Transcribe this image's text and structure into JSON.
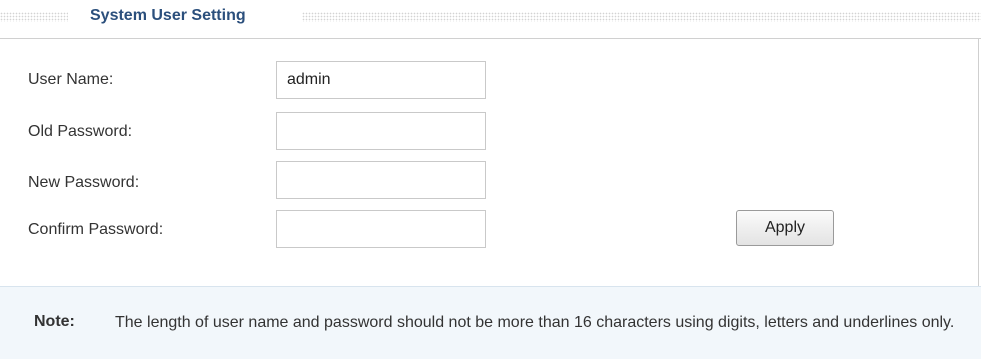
{
  "section": {
    "title": "System User Setting"
  },
  "form": {
    "username_label": "User Name:",
    "username_value": "admin",
    "old_password_label": "Old Password:",
    "old_password_value": "",
    "new_password_label": "New Password:",
    "new_password_value": "",
    "confirm_password_label": "Confirm Password:",
    "confirm_password_value": "",
    "apply_label": "Apply"
  },
  "note": {
    "label": "Note:",
    "text": "The length of user name and password should not be more than 16 characters using digits, letters and underlines only."
  }
}
